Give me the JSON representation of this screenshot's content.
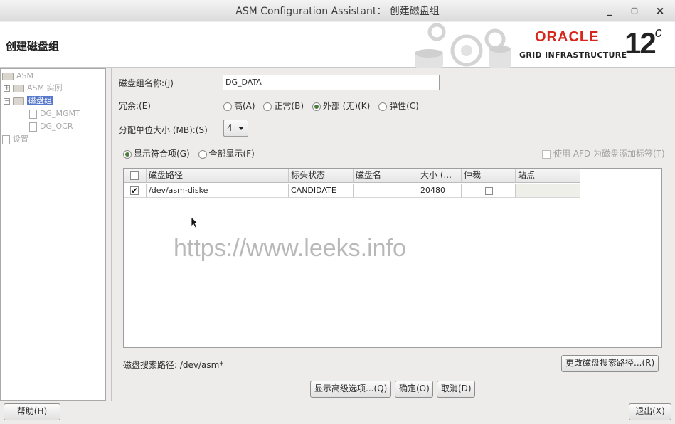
{
  "window": {
    "title": "ASM Configuration Assistant： 创建磁盘组",
    "minimize": "_",
    "maximize": "▢",
    "close": "×"
  },
  "header": {
    "page_title": "创建磁盘组",
    "brand": "ORACLE",
    "brand_sub": "GRID INFRASTRUCTURE",
    "version": "12",
    "version_suffix": "c",
    "brand_color": "#d7261b"
  },
  "tree": {
    "items": [
      {
        "label": "ASM",
        "icon": "folder-open-icon"
      },
      {
        "label": "ASM 实例",
        "icon": "folder-icon"
      },
      {
        "label": "磁盘组",
        "icon": "folder-open-icon",
        "selected": true
      },
      {
        "label": "DG_MGMT",
        "icon": "document-icon"
      },
      {
        "label": "DG_OCR",
        "icon": "document-icon"
      },
      {
        "label": "设置",
        "icon": "document-icon"
      }
    ],
    "selected_color": "#5577cc"
  },
  "form": {
    "name_label": "磁盘组名称:(J)",
    "name_value": "DG_DATA",
    "redundancy_label": "冗余:(E)",
    "redundancy_options": [
      "高(A)",
      "正常(B)",
      "外部 (无)(K)",
      "弹性(C)"
    ],
    "redundancy_selected": "外部 (无)(K)",
    "au_label": "分配单位大小 (MB):(S)",
    "au_value": "4",
    "filter_options": [
      "显示符合项(G)",
      "全部显示(F)"
    ],
    "filter_selected": "显示符合项(G)",
    "afd_label": "使用 AFD 为磁盘添加标签(T)"
  },
  "table": {
    "columns": [
      "",
      "磁盘路径",
      "标头状态",
      "磁盘名",
      "大小 (...",
      "仲裁",
      "站点"
    ],
    "rows": [
      {
        "selected": true,
        "path": "/dev/asm-diske",
        "header_status": "CANDIDATE",
        "disk_name": "",
        "size": "20480",
        "quorum": false,
        "site": ""
      }
    ]
  },
  "watermark": "https://www.leeks.info",
  "discovery": {
    "label": "磁盘搜索路径: /dev/asm*",
    "change_button": "更改磁盘搜索路径...(R)"
  },
  "buttons": {
    "advanced": "显示高级选项...(Q)",
    "ok": "确定(O)",
    "cancel": "取消(D)",
    "help": "帮助(H)",
    "exit": "退出(X)"
  }
}
